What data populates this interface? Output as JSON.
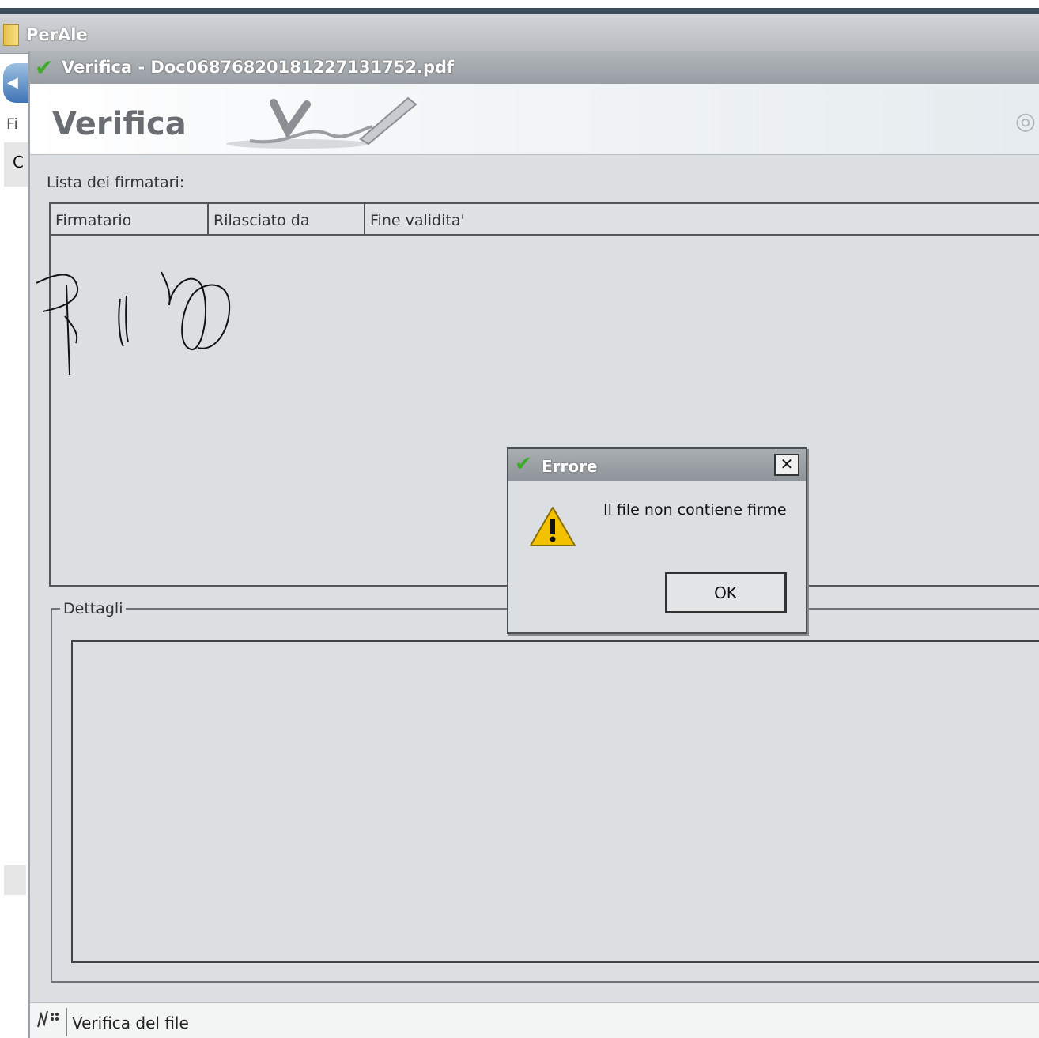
{
  "outer_window": {
    "title": "PerAle",
    "menu_partial": "Fi",
    "partial_letter": "C"
  },
  "window": {
    "title": "Verifica - Doc06876820181227131752.pdf",
    "banner_title": "Verifica"
  },
  "signers": {
    "label": "Lista dei firmatari:",
    "columns": [
      "Firmatario",
      "Rilasciato da",
      "Fine validita'"
    ],
    "rows": []
  },
  "details": {
    "label": "Dettagli"
  },
  "status_bar": {
    "text": "Verifica del file"
  },
  "dialog": {
    "title": "Errore",
    "message": "Il file non contiene firme",
    "ok_label": "OK",
    "close_glyph": "✕"
  },
  "colors": {
    "titlebar": "#979da2",
    "window_bg": "#dcdfe1",
    "accent_check": "#3faa2a",
    "warning": "#f2c200"
  },
  "icons": [
    "folder-icon",
    "back-arrow-icon",
    "check-icon",
    "signature-logo-icon",
    "warning-icon",
    "close-icon",
    "status-icon"
  ]
}
